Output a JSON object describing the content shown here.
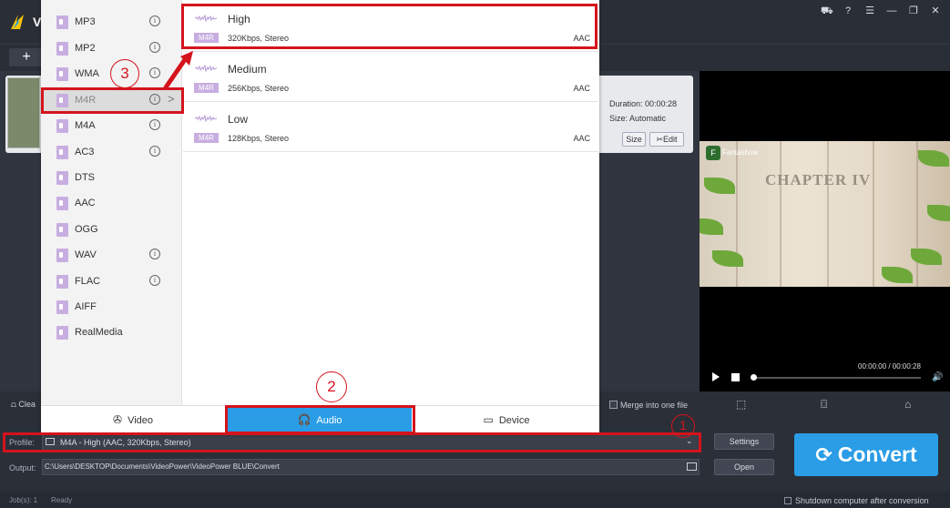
{
  "app": {
    "title": "V",
    "window_controls": [
      "cart-icon",
      "help-icon",
      "list-icon",
      "minimize-icon",
      "maximize-icon",
      "close-icon"
    ]
  },
  "toolbar": {
    "add_label": "+"
  },
  "file": {
    "duration": "Duration: 00:00:28",
    "size": "Size: Automatic",
    "size_btn": "Size",
    "edit_btn": "Edit"
  },
  "preview": {
    "logo_text": "F",
    "brand": "Fantashow",
    "chapter": "CHAPTER IV",
    "time": "00:00:00 / 00:00:28"
  },
  "format_list": {
    "items": [
      {
        "label": "MP3",
        "info": true
      },
      {
        "label": "MP2",
        "info": true
      },
      {
        "label": "WMA",
        "info": true
      },
      {
        "label": "M4R",
        "info": true,
        "selected": true
      },
      {
        "label": "M4A",
        "info": true
      },
      {
        "label": "AC3",
        "info": true
      },
      {
        "label": "DTS",
        "info": false
      },
      {
        "label": "AAC",
        "info": false
      },
      {
        "label": "OGG",
        "info": false
      },
      {
        "label": "WAV",
        "info": true
      },
      {
        "label": "FLAC",
        "info": true
      },
      {
        "label": "AIFF",
        "info": false
      },
      {
        "label": "RealMedia",
        "info": false
      }
    ],
    "info_glyph": "i",
    "chevron_glyph": ">"
  },
  "quality": {
    "rows": [
      {
        "name": "High",
        "tag": "M4R",
        "desc": "320Kbps, Stereo",
        "codec": "AAC"
      },
      {
        "name": "Medium",
        "tag": "M4R",
        "desc": "256Kbps, Stereo",
        "codec": "AAC"
      },
      {
        "name": "Low",
        "tag": "M4R",
        "desc": "128Kbps, Stereo",
        "codec": "AAC"
      }
    ]
  },
  "categories": {
    "video": "Video",
    "audio": "Audio",
    "device": "Device"
  },
  "bottom": {
    "clear": "Clea",
    "merge": "Merge into one file",
    "profile_label": "Profile:",
    "profile_value": "M4A - High (AAC, 320Kbps, Stereo)",
    "output_label": "Output:",
    "output_value": "C:\\Users\\DESKTOP\\Documents\\VideoPower\\VideoPower BLUE\\Convert",
    "settings": "Settings",
    "open": "Open",
    "convert": "Convert"
  },
  "status": {
    "jobs": "Job(s): 1",
    "ready": "Ready",
    "shutdown": "Shutdown computer after conversion"
  },
  "annotations": {
    "one": "1",
    "two": "2",
    "three": "3"
  },
  "colors": {
    "accent": "#2a9de6",
    "annotation_red": "#d4141c",
    "format_icon": "#c8aee0"
  }
}
